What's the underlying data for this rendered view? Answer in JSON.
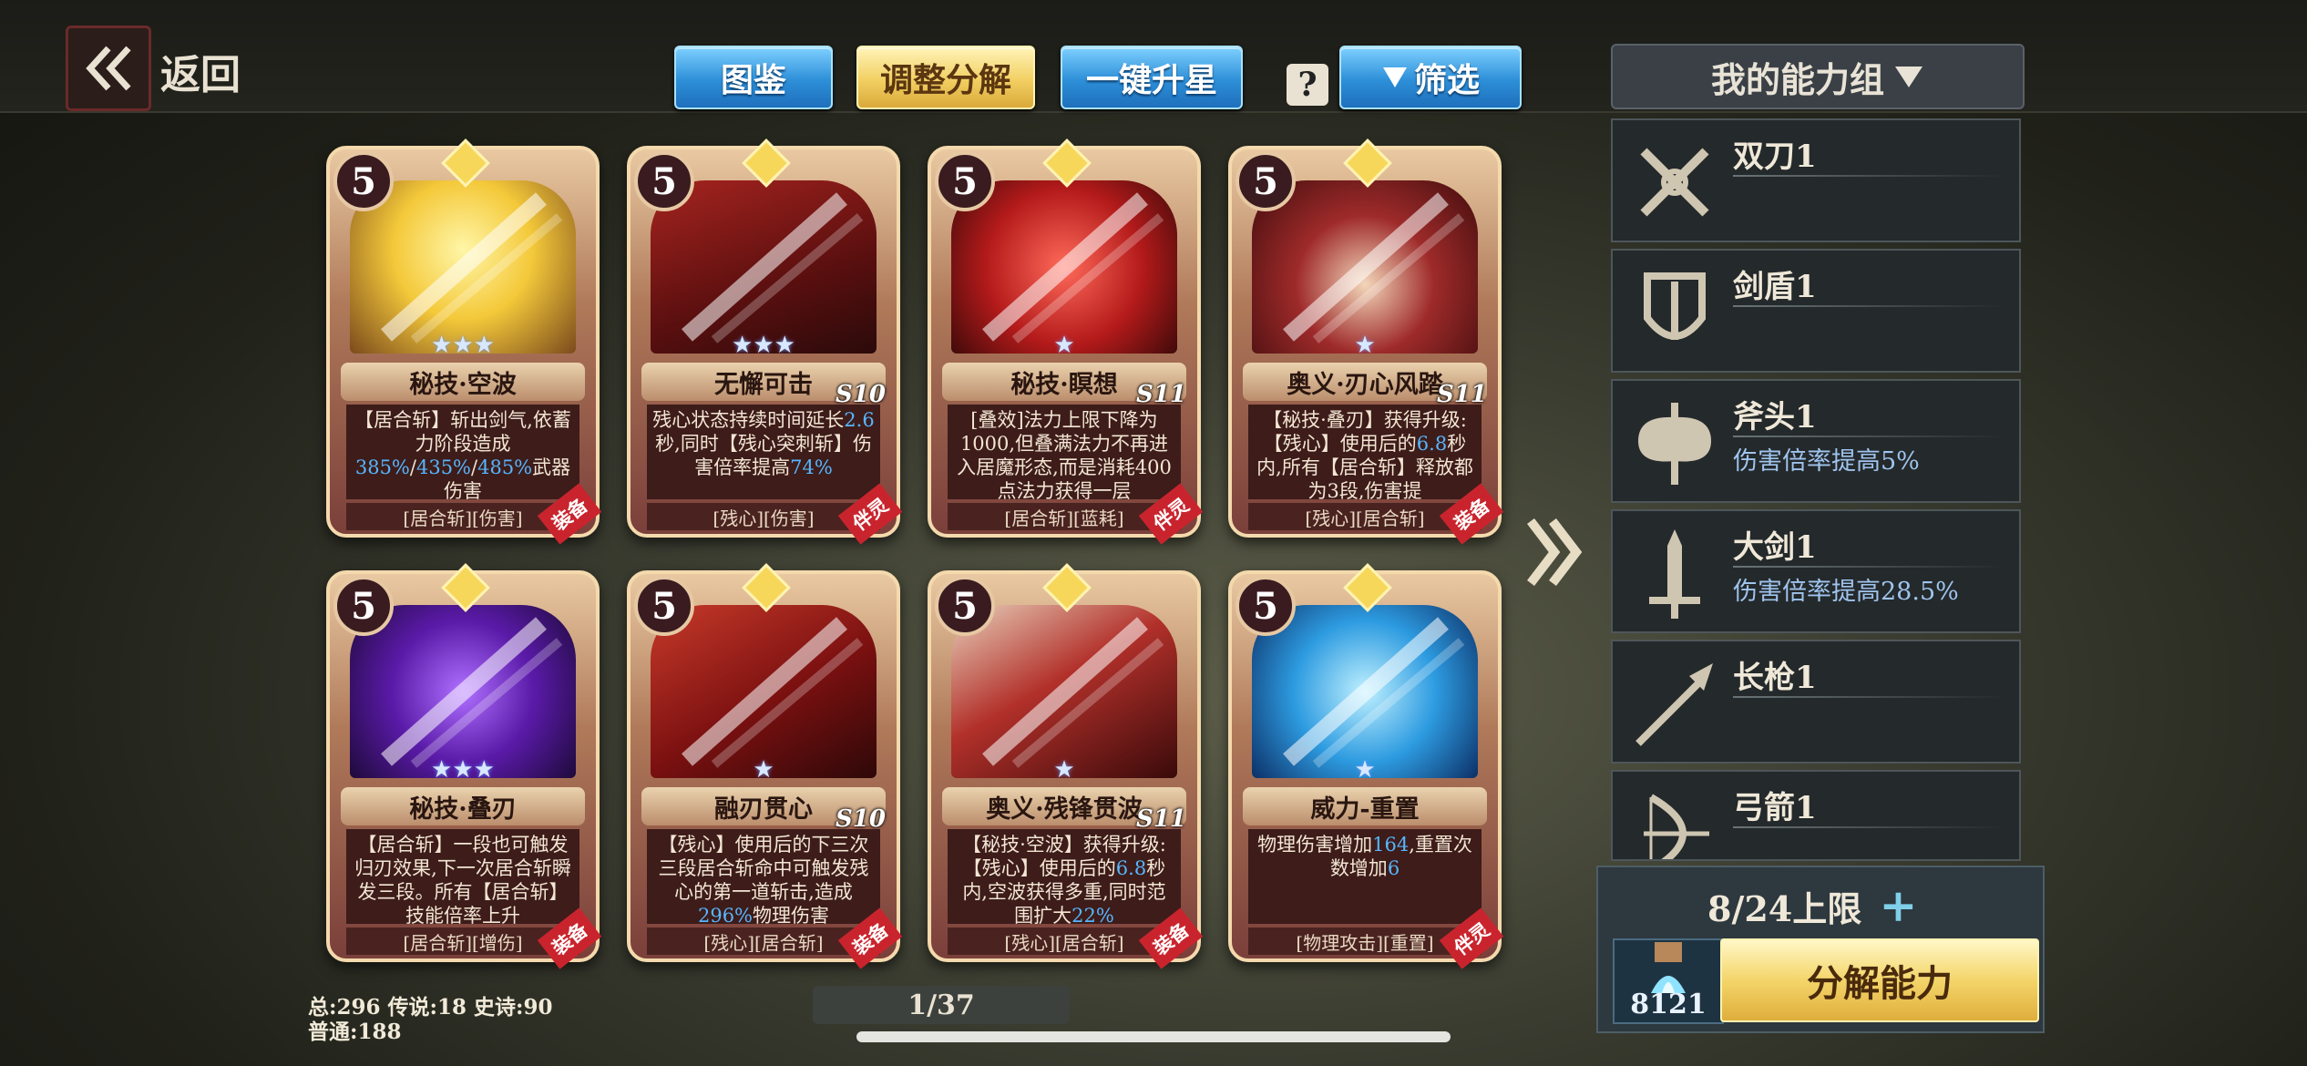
{
  "header": {
    "back_label": "返回",
    "tabs": [
      {
        "label": "图鉴"
      },
      {
        "label": "调整分解"
      },
      {
        "label": "一键升星"
      }
    ],
    "help_label": "?",
    "filter_label": "筛选",
    "ability_group_label": "我的能力组"
  },
  "cards": [
    {
      "level": "5",
      "name": "秘技·空波",
      "season": "",
      "stars": "★★★",
      "desc": [
        "【居合斩】斩出剑气,依蓄力阶段造成",
        {
          "hl": "385%"
        },
        "/",
        {
          "hl": "435%"
        },
        "/",
        {
          "hl": "485%"
        },
        "武器伤害"
      ],
      "tags": "[居合斩][伤害]",
      "type": "装备",
      "art": "gold"
    },
    {
      "level": "5",
      "name": "无懈可击",
      "season": "S10",
      "stars": "★★★",
      "desc": [
        "残心状态持续时间延长",
        {
          "hl": "2.6"
        },
        "秒,同时【残心突刺斩】伤害倍率提高",
        {
          "hl": "74%"
        }
      ],
      "tags": "[残心][伤害]",
      "type": "伴灵",
      "art": "red"
    },
    {
      "level": "5",
      "name": "秘技·瞑想",
      "season": "S11",
      "stars": "★",
      "desc": [
        "[叠效]法力上限下降为1000,但叠满法力不再进入居魔形态,而是消耗400点法力获得一层"
      ],
      "tags": "[居合斩][蓝耗]",
      "type": "伴灵",
      "art": "crimson"
    },
    {
      "level": "5",
      "name": "奥义·刃心风踏",
      "season": "S11",
      "stars": "★",
      "desc": [
        "【秘技·叠刃】获得升级:【残心】使用后的",
        {
          "hl": "6.8"
        },
        "秒内,所有【居合斩】释放都为3段,伤害提"
      ],
      "tags": "[残心][居合斩]",
      "type": "装备",
      "art": "maroon"
    },
    {
      "level": "5",
      "name": "秘技·叠刃",
      "season": "",
      "stars": "★★★",
      "desc": [
        "【居合斩】一段也可触发归刃效果,下一次居合斩瞬发三段。所有【居合斩】技能倍率上升"
      ],
      "tags": "[居合斩][增伤]",
      "type": "装备",
      "art": "purple"
    },
    {
      "level": "5",
      "name": "融刃贯心",
      "season": "S10",
      "stars": "★",
      "desc": [
        "【残心】使用后的下三次三段居合斩命中可触发残心的第一道斩击,造成",
        {
          "hl": "296%"
        },
        "物理伤害"
      ],
      "tags": "[残心][居合斩]",
      "type": "装备",
      "art": "red2"
    },
    {
      "level": "5",
      "name": "奥义·残锋贯波",
      "season": "S11",
      "stars": "★",
      "desc": [
        "【秘技·空波】获得升级:【残心】使用后的",
        {
          "hl": "6.8"
        },
        "秒内,空波获得多重,同时范围扩大",
        {
          "hl": "22%"
        }
      ],
      "tags": "[残心][居合斩]",
      "type": "装备",
      "art": "red3"
    },
    {
      "level": "5",
      "name": "威力-重置",
      "season": "",
      "stars": "★",
      "desc": [
        "物理伤害增加",
        {
          "hl": "164"
        },
        ",重置次数增加",
        {
          "hl": "6"
        }
      ],
      "tags": "[物理攻击][重置]",
      "type": "伴灵",
      "art": "blue"
    }
  ],
  "abilities": [
    {
      "name": "双刀1",
      "effect": "",
      "icon": "dual-blades-icon"
    },
    {
      "name": "剑盾1",
      "effect": "",
      "icon": "sword-shield-icon"
    },
    {
      "name": "斧头1",
      "effect": "伤害倍率提高5%",
      "icon": "axe-icon"
    },
    {
      "name": "大剑1",
      "effect": "伤害倍率提高28.5%",
      "icon": "greatsword-icon"
    },
    {
      "name": "长枪1",
      "effect": "",
      "icon": "spear-icon"
    },
    {
      "name": "弓箭1",
      "effect": "",
      "icon": "bow-icon"
    }
  ],
  "limit": {
    "text": "8/24上限",
    "plus": "+"
  },
  "resource": {
    "count": "8121",
    "icon": "water-crystal-icon"
  },
  "decompose_label": "分解能力",
  "stats": {
    "line1": "总:296 传说:18 史诗:90",
    "line2": "普通:188"
  },
  "pager": "1/37",
  "colors": {
    "accent_blue": "#2d8fd8",
    "accent_gold": "#f2cf62",
    "highlight": "#56b6ff",
    "type_badge": "#c9242d"
  }
}
